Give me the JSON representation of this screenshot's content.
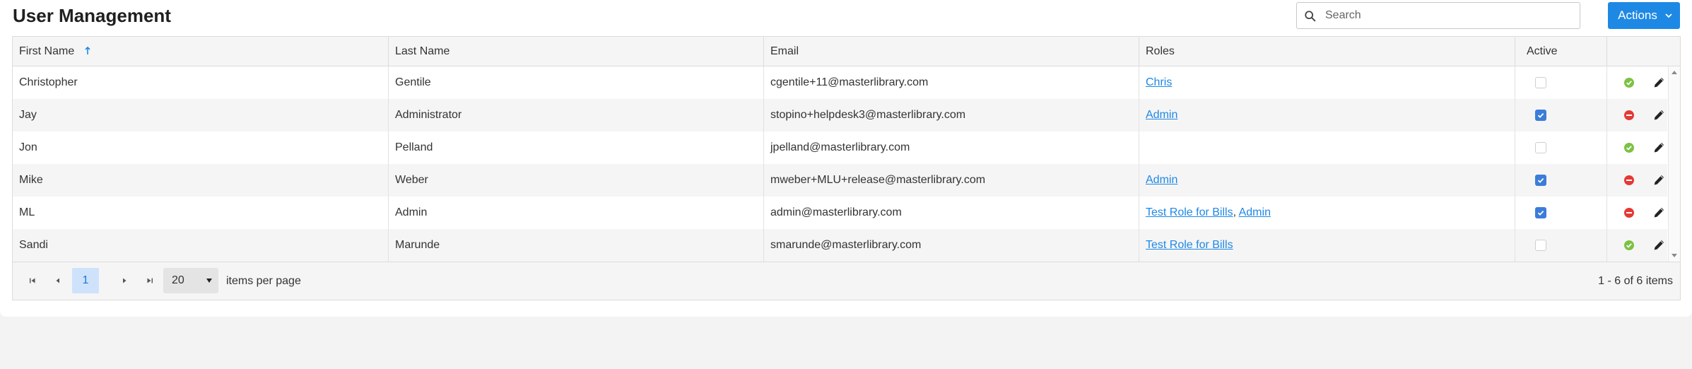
{
  "header": {
    "title": "User Management",
    "search_placeholder": "Search",
    "search_value": "",
    "actions_label": "Actions"
  },
  "grid": {
    "columns": {
      "first_name": "First Name",
      "last_name": "Last Name",
      "email": "Email",
      "roles": "Roles",
      "active": "Active"
    },
    "sort": {
      "column": "First Name",
      "direction": "ascending"
    },
    "rows": [
      {
        "first": "Christopher",
        "last": "Gentile",
        "email": "cgentile+11@masterlibrary.com",
        "roles": [
          "Chris"
        ],
        "active": false,
        "status_icon": "check-circle-icon"
      },
      {
        "first": "Jay",
        "last": "Administrator",
        "email": "stopino+helpdesk3@masterlibrary.com",
        "roles": [
          "Admin"
        ],
        "active": true,
        "status_icon": "minus-circle-icon"
      },
      {
        "first": "Jon",
        "last": "Pelland",
        "email": "jpelland@masterlibrary.com",
        "roles": [],
        "active": false,
        "status_icon": "check-circle-icon"
      },
      {
        "first": "Mike",
        "last": "Weber",
        "email": "mweber+MLU+release@masterlibrary.com",
        "roles": [
          "Admin"
        ],
        "active": true,
        "status_icon": "minus-circle-icon"
      },
      {
        "first": "ML",
        "last": "Admin",
        "email": "admin@masterlibrary.com",
        "roles": [
          "Test Role for Bills",
          "Admin"
        ],
        "active": true,
        "status_icon": "minus-circle-icon"
      },
      {
        "first": "Sandi",
        "last": "Marunde",
        "email": "smarunde@masterlibrary.com",
        "roles": [
          "Test Role for Bills"
        ],
        "active": false,
        "status_icon": "check-circle-icon"
      }
    ]
  },
  "pager": {
    "current_page": "1",
    "page_size": "20",
    "items_per_page_label": "items per page",
    "range_text": "1 - 6 of 6 items"
  },
  "colors": {
    "accent": "#1e88e5",
    "success": "#7cc243",
    "danger": "#e53935",
    "checkbox_on": "#3b7dd8"
  }
}
